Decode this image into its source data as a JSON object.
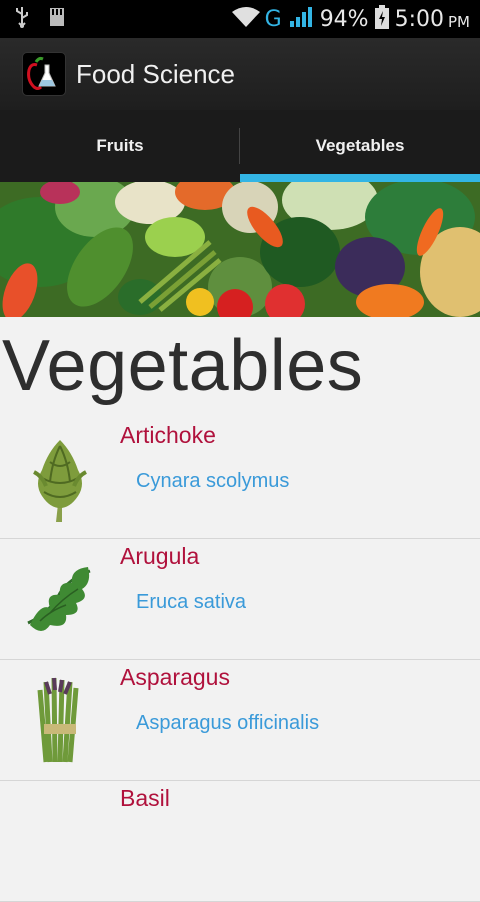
{
  "status_bar": {
    "battery": "94%",
    "network": "G",
    "time": "5:00",
    "ampm": "PM",
    "icons": [
      "usb-icon",
      "sdcard-icon",
      "wifi-icon",
      "signal-icon",
      "battery-charging-icon"
    ]
  },
  "app": {
    "title": "Food Science",
    "icon": "app-logo-icon"
  },
  "tabs": [
    {
      "label": "Fruits",
      "selected": false
    },
    {
      "label": "Vegetables",
      "selected": true
    }
  ],
  "colors": {
    "accent": "#33b5e5",
    "item_name": "#b0113c",
    "scientific_name": "#3a9ad9"
  },
  "main": {
    "section_title": "Vegetables",
    "items": [
      {
        "name": "Artichoke",
        "scientific": "Cynara scolymus",
        "icon": "artichoke-icon"
      },
      {
        "name": "Arugula",
        "scientific": "Eruca sativa",
        "icon": "arugula-icon"
      },
      {
        "name": "Asparagus",
        "scientific": "Asparagus officinalis",
        "icon": "asparagus-icon"
      },
      {
        "name": "Basil",
        "scientific": "",
        "icon": "basil-icon"
      }
    ]
  }
}
